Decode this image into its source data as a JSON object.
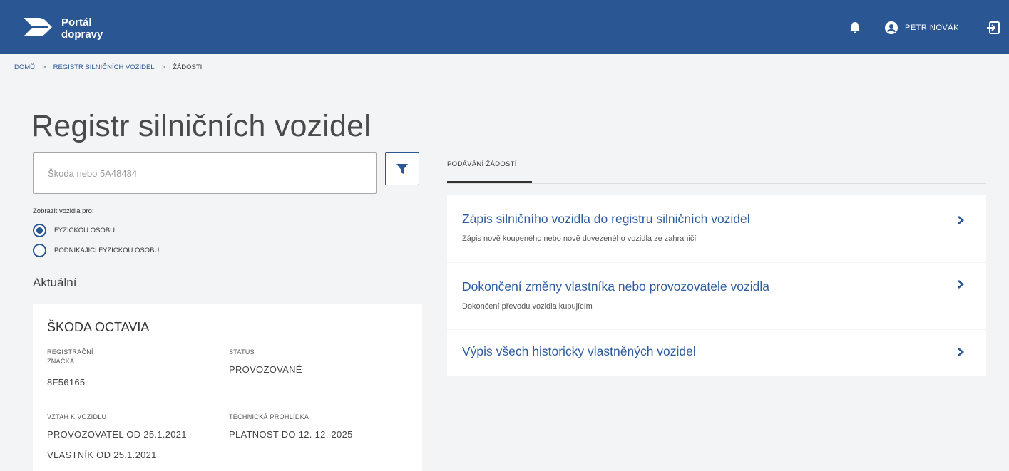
{
  "header": {
    "brand_line1": "Portál",
    "brand_line2": "dopravy",
    "user_name": "PETR NOVÁK",
    "icons": [
      "portal-logo-icon",
      "bell-icon",
      "user-avatar-icon",
      "logout-icon"
    ]
  },
  "breadcrumb": {
    "home": "DOMŮ",
    "registry": "REGISTR SILNIČNÍCH VOZIDEL",
    "current": "ŽÁDOSTI",
    "separator": ">"
  },
  "page": {
    "title": "Registr silničních vozidel"
  },
  "search": {
    "placeholder": "Škoda nebo 5A48484",
    "filter_icon": "filter-icon"
  },
  "filter": {
    "label": "Zobrazit vozidla pro:",
    "options": [
      {
        "label": "FYZICKOU OSOBU",
        "selected": true
      },
      {
        "label": "PODNIKAJÍCÍ FYZICKOU OSOBU",
        "selected": false
      }
    ]
  },
  "current": {
    "heading": "Aktuální",
    "vehicle": {
      "name": "ŠKODA OCTAVIA",
      "reg_label_1": "REGISTRAČNÍ",
      "reg_label_2": "ZNAČKA",
      "reg_value": "8F56165",
      "status_label": "STATUS",
      "status_value": "PROVOZOVANÉ",
      "relation_label": "VZTAH K VOZIDLU",
      "relation_value_1": "PROVOZOVATEL OD 25.1.2021",
      "relation_value_2": "VLASTNÍK OD 25.1.2021",
      "inspection_label": "TECHNICKÁ PROHLÍDKA",
      "inspection_value": "PLATNOST DO 12. 12. 2025"
    }
  },
  "requests": {
    "tab_label": "PODÁVÁNÍ ŽÁDOSTÍ",
    "items": [
      {
        "title": "Zápis silničního vozidla do registru silničních vozidel",
        "subtitle": "Zápis nově koupeného nebo nově dovezeného vozidla ze zahraničí"
      },
      {
        "title": "Dokončení změny vlastníka nebo provozovatele vozidla",
        "subtitle": "Dokončení převodu vozidla kupujícím"
      },
      {
        "title": "Výpis všech historicky vlastněných vozidel",
        "subtitle": ""
      }
    ]
  },
  "colors": {
    "header_bg": "#2b5694",
    "link_blue": "#2d5da1",
    "page_bg": "#f3f4f6"
  }
}
